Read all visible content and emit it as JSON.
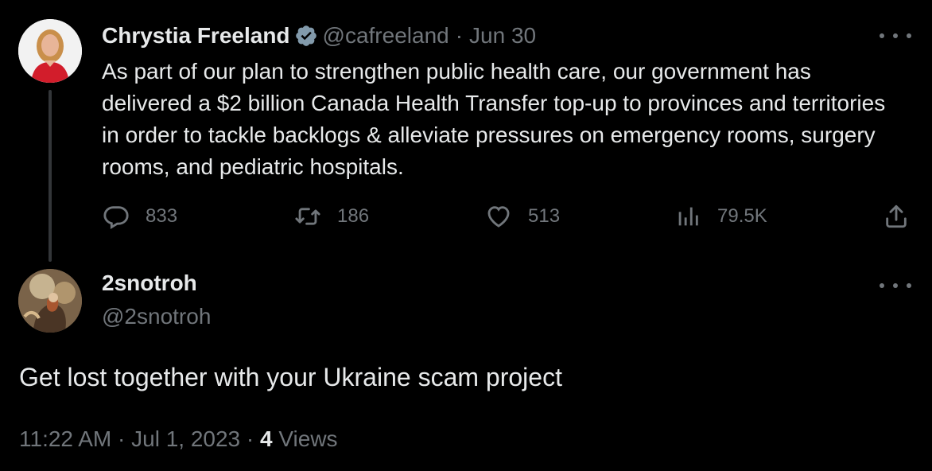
{
  "original_tweet": {
    "display_name": "Chrystia Freeland",
    "handle": "@cafreeland",
    "separator": "·",
    "date": "Jun 30",
    "text": "As part of our plan to strengthen public health care, our government has delivered a $2 billion Canada Health Transfer top-up to provinces and territories in order to tackle backlogs & alleviate pressures on emergency rooms, surgery rooms, and pediatric hospitals.",
    "verified": true,
    "actions": {
      "replies": "833",
      "retweets": "186",
      "likes": "513",
      "views": "79.5K"
    }
  },
  "reply": {
    "display_name": "2snotroh",
    "handle": "@2snotroh",
    "text": "Get lost together with your Ukraine scam project",
    "time": "11:22 AM",
    "separator": "·",
    "date": "Jul 1, 2023",
    "views_count": "4",
    "views_label": "Views"
  },
  "icons": {
    "more": "more-horizontal-icon",
    "reply": "reply-icon",
    "retweet": "retweet-icon",
    "like": "heart-icon",
    "views": "analytics-icon",
    "share": "share-icon",
    "verified": "verified-badge-icon"
  },
  "colors": {
    "background": "#000000",
    "text_primary": "#e7e9ea",
    "text_muted": "#71767b",
    "verified_badge": "#829aab",
    "thread_line": "#333639"
  }
}
